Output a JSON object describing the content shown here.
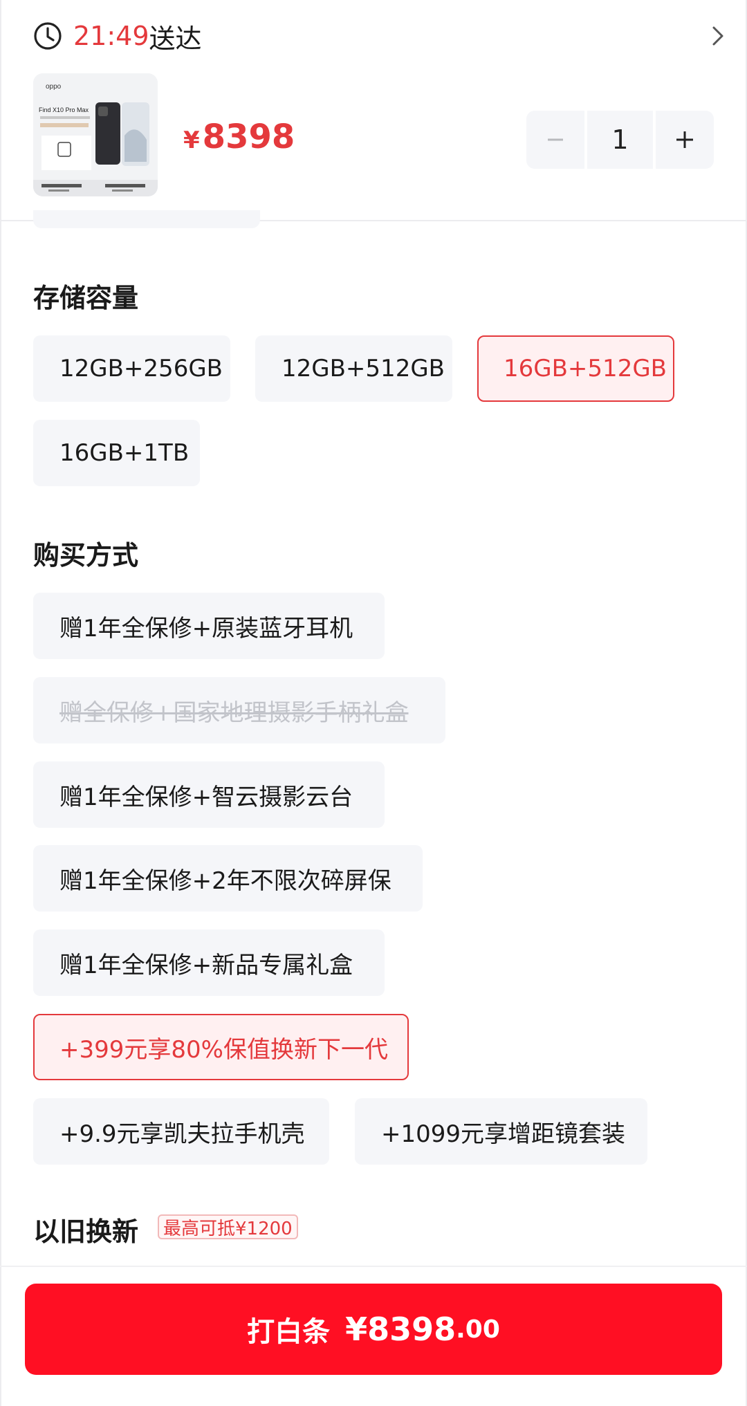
{
  "header": {
    "delivery_time": "21:49",
    "delivery_suffix": "送达"
  },
  "product": {
    "price_symbol": "¥",
    "price": "8398",
    "quantity": "1",
    "thumb": {
      "brand": "oppo",
      "model": "Find X10 Pro Max"
    }
  },
  "storage": {
    "title": "存储容量",
    "options": [
      {
        "label": "12GB+256GB"
      },
      {
        "label": "12GB+512GB"
      },
      {
        "label": "16GB+512GB"
      },
      {
        "label": "16GB+1TB"
      }
    ],
    "selected": "16GB+512GB"
  },
  "purchase": {
    "title": "购买方式",
    "options": [
      {
        "label": "赠1年全保修+原装蓝牙耳机"
      },
      {
        "label": "赠全保修+国家地理摄影手柄礼盒"
      },
      {
        "label": "赠1年全保修+智云摄影云台"
      },
      {
        "label": "赠1年全保修+2年不限次碎屏保"
      },
      {
        "label": "赠1年全保修+新品专属礼盒"
      },
      {
        "label": "+399元享80%保值换新下一代"
      },
      {
        "label": "+9.9元享凯夫拉手机壳"
      },
      {
        "label": "+1099元享增距镜套装"
      }
    ],
    "selected": "+399元享80%保值换新下一代",
    "disabled": "赠全保修+国家地理摄影手柄礼盒"
  },
  "tradein": {
    "title": "以旧换新",
    "badge": "最高可抵¥1200"
  },
  "pay": {
    "label": "打白条",
    "amount": "¥8398",
    "cents": ".00"
  },
  "colors": {
    "accent": "#e4393c",
    "button": "#ff0f23",
    "chip_bg": "#f5f6f9"
  }
}
